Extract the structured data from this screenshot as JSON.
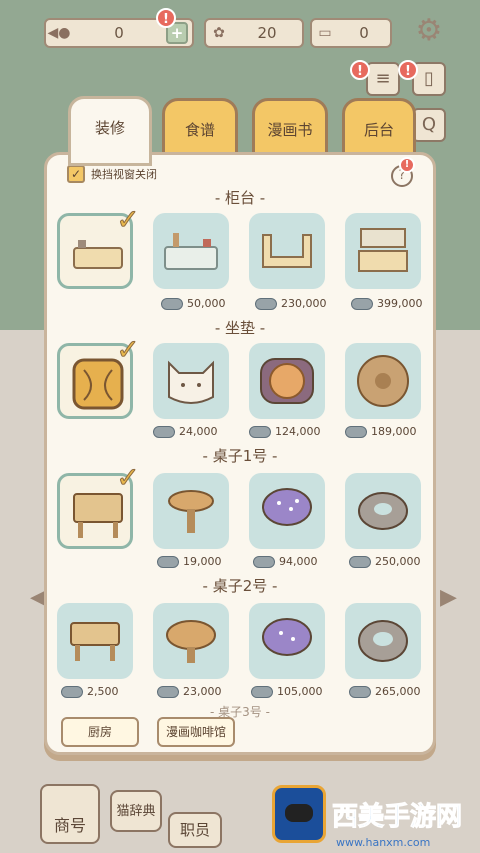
{
  "topbar": {
    "fish_count": "0",
    "paw_count": "20",
    "ticket_count": "0"
  },
  "tabs": [
    {
      "label": "装修"
    },
    {
      "label": "食谱"
    },
    {
      "label": "漫画书"
    },
    {
      "label": "后台"
    }
  ],
  "panel": {
    "checkbox_label": "换挡视窗关闭",
    "help": "?",
    "sections": [
      {
        "title": "- 柜台 -",
        "prices": [
          "",
          "50,000",
          "230,000",
          "399,000"
        ]
      },
      {
        "title": "- 坐垫 -",
        "prices": [
          "",
          "24,000",
          "124,000",
          "189,000"
        ]
      },
      {
        "title": "- 桌子1号 -",
        "prices": [
          "",
          "19,000",
          "94,000",
          "250,000"
        ]
      },
      {
        "title": "- 桌子2号 -",
        "prices": [
          "2,500",
          "23,000",
          "105,000",
          "265,000"
        ]
      },
      {
        "title": "- 桌子3号 -"
      }
    ],
    "buttons": {
      "kitchen": "厨房",
      "manga_cafe": "漫画咖啡馆"
    }
  },
  "nav": {
    "shop": "商号",
    "cat_dict": "猫辞典",
    "staff": "职员"
  },
  "watermark": {
    "text": "西美手游网",
    "url": "www.hanxm.com"
  },
  "colors": {
    "accent": "#f3c766",
    "panel": "#fbf7ee",
    "item_bg": "#cae1df",
    "wall": "#93a892"
  },
  "icons": {
    "fish": "fish-icon",
    "paw": "paw-icon",
    "ticket": "ticket-icon",
    "gear": "gear-icon",
    "check": "check-icon",
    "alert": "alert-icon"
  }
}
